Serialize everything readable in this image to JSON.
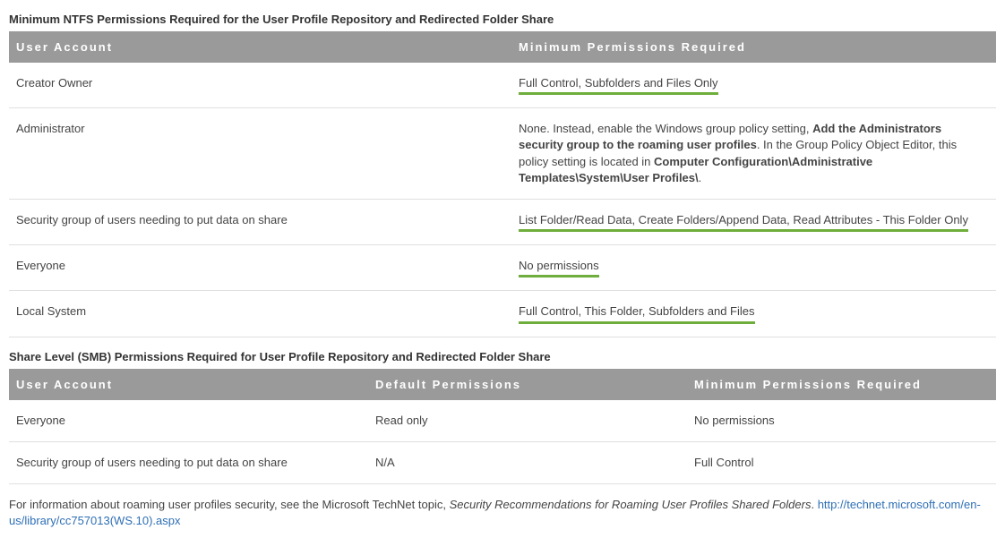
{
  "table1": {
    "title": "Minimum NTFS Permissions Required for the User Profile Repository and Redirected Folder Share",
    "headers": [
      "User Account",
      "Minimum Permissions Required"
    ],
    "rows": [
      {
        "account": "Creator Owner",
        "perm_text": "Full Control, Subfolders and Files Only",
        "underline": true
      },
      {
        "account": "Administrator",
        "perm_prefix": "None. Instead, enable the Windows group policy setting, ",
        "perm_bold": "Add the Administrators security group to the roaming user profiles",
        "perm_mid": ". In the Group Policy Object Editor, this policy setting is located in ",
        "perm_bold2": "Computer Configuration\\Administrative Templates\\System\\User Profiles\\",
        "perm_suffix": ".",
        "underline": false
      },
      {
        "account": "Security group of users needing to put data on share",
        "perm_text": "List Folder/Read Data, Create Folders/Append Data, Read Attributes - This Folder Only",
        "underline": true
      },
      {
        "account": "Everyone",
        "perm_text": "No permissions",
        "underline": true
      },
      {
        "account": "Local System",
        "perm_text": "Full Control, This Folder, Subfolders and Files",
        "underline": true
      }
    ]
  },
  "table2": {
    "title": "Share Level (SMB) Permissions Required for User Profile Repository and Redirected Folder Share",
    "headers": [
      "User Account",
      "Default Permissions",
      "Minimum Permissions Required"
    ],
    "rows": [
      {
        "c0": "Everyone",
        "c1": "Read only",
        "c2": "No permissions"
      },
      {
        "c0": "Security group of users needing to put data on share",
        "c1": "N/A",
        "c2": "Full Control"
      }
    ]
  },
  "footer": {
    "text_prefix": "For information about roaming user profiles security, see the Microsoft TechNet topic, ",
    "text_italic": "Security Recommendations for Roaming User Profiles Shared Folders",
    "text_mid": ". ",
    "link": "http://technet.microsoft.com/en-us/library/cc757013(WS.10).aspx"
  }
}
